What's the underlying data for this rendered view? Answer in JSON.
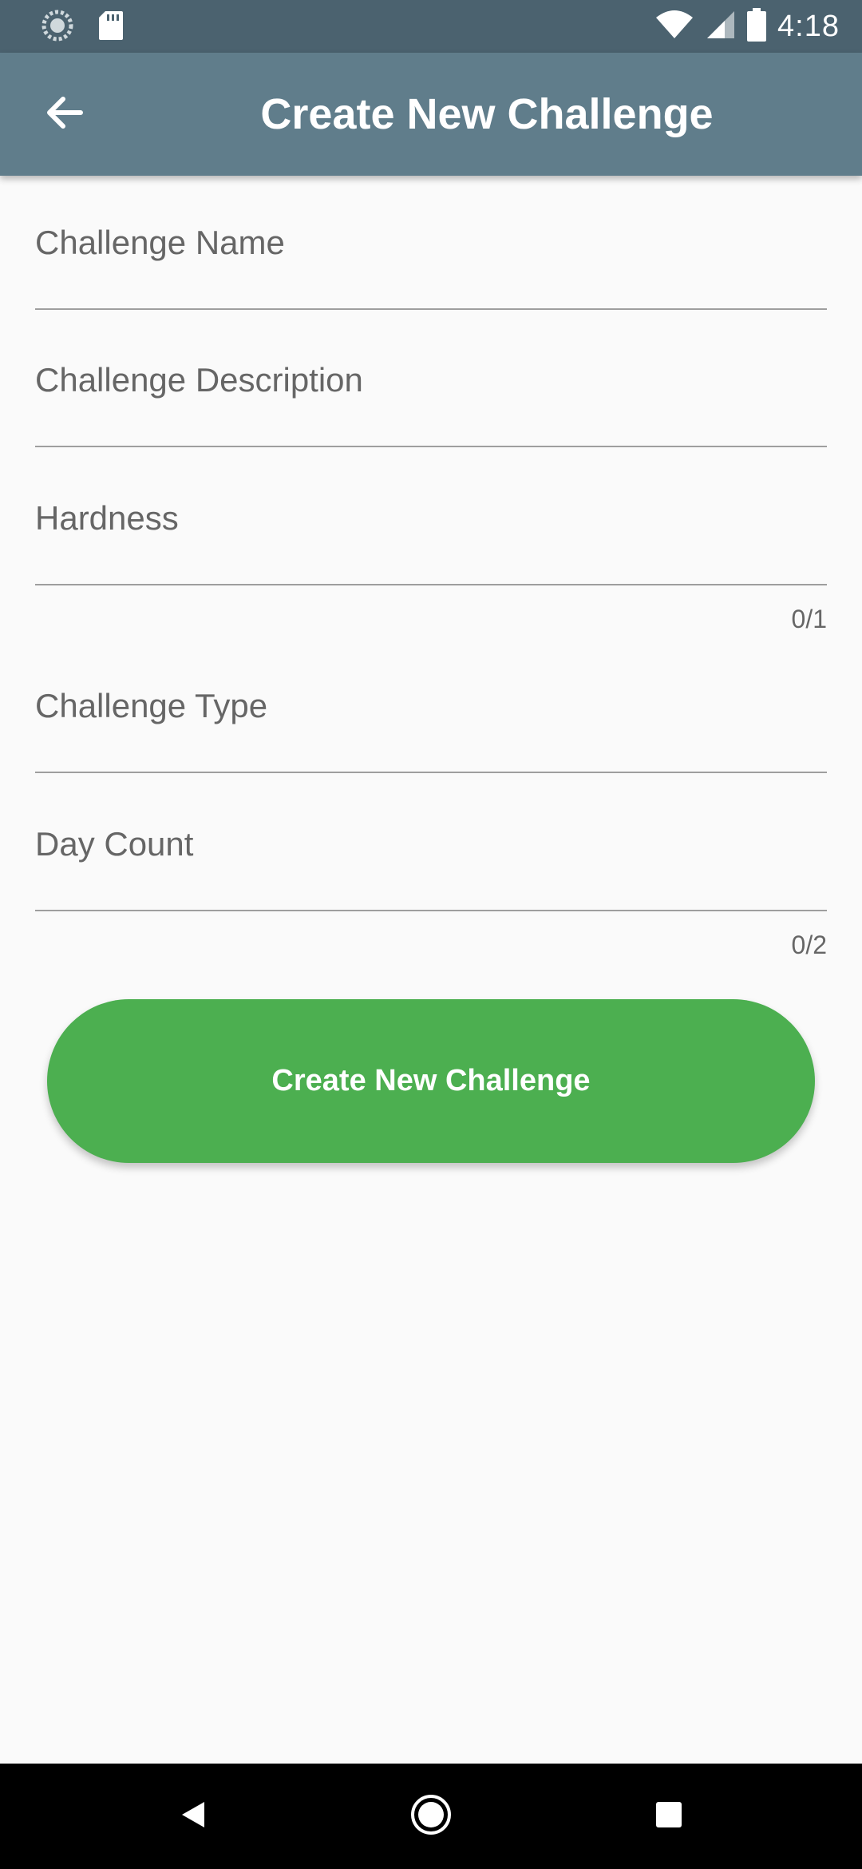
{
  "status_bar": {
    "time": "4:18",
    "icons": [
      "sync-icon",
      "sd-card-icon",
      "wifi-icon",
      "cell-signal-icon",
      "battery-icon"
    ]
  },
  "app_bar": {
    "back_icon": "arrow-back-icon",
    "title": "Create New Challenge",
    "color": "#607d8b"
  },
  "form": {
    "fields": [
      {
        "label": "Challenge Name"
      },
      {
        "label": "Challenge Description"
      },
      {
        "label": "Hardness",
        "counter": "0/1"
      },
      {
        "label": "Challenge Type"
      },
      {
        "label": "Day Count",
        "counter": "0/2"
      }
    ],
    "submit_label": "Create New Challenge",
    "submit_color": "#4caf50"
  },
  "nav_bar": {
    "icons": [
      "back-triangle-icon",
      "home-circle-icon",
      "recents-square-icon"
    ]
  }
}
